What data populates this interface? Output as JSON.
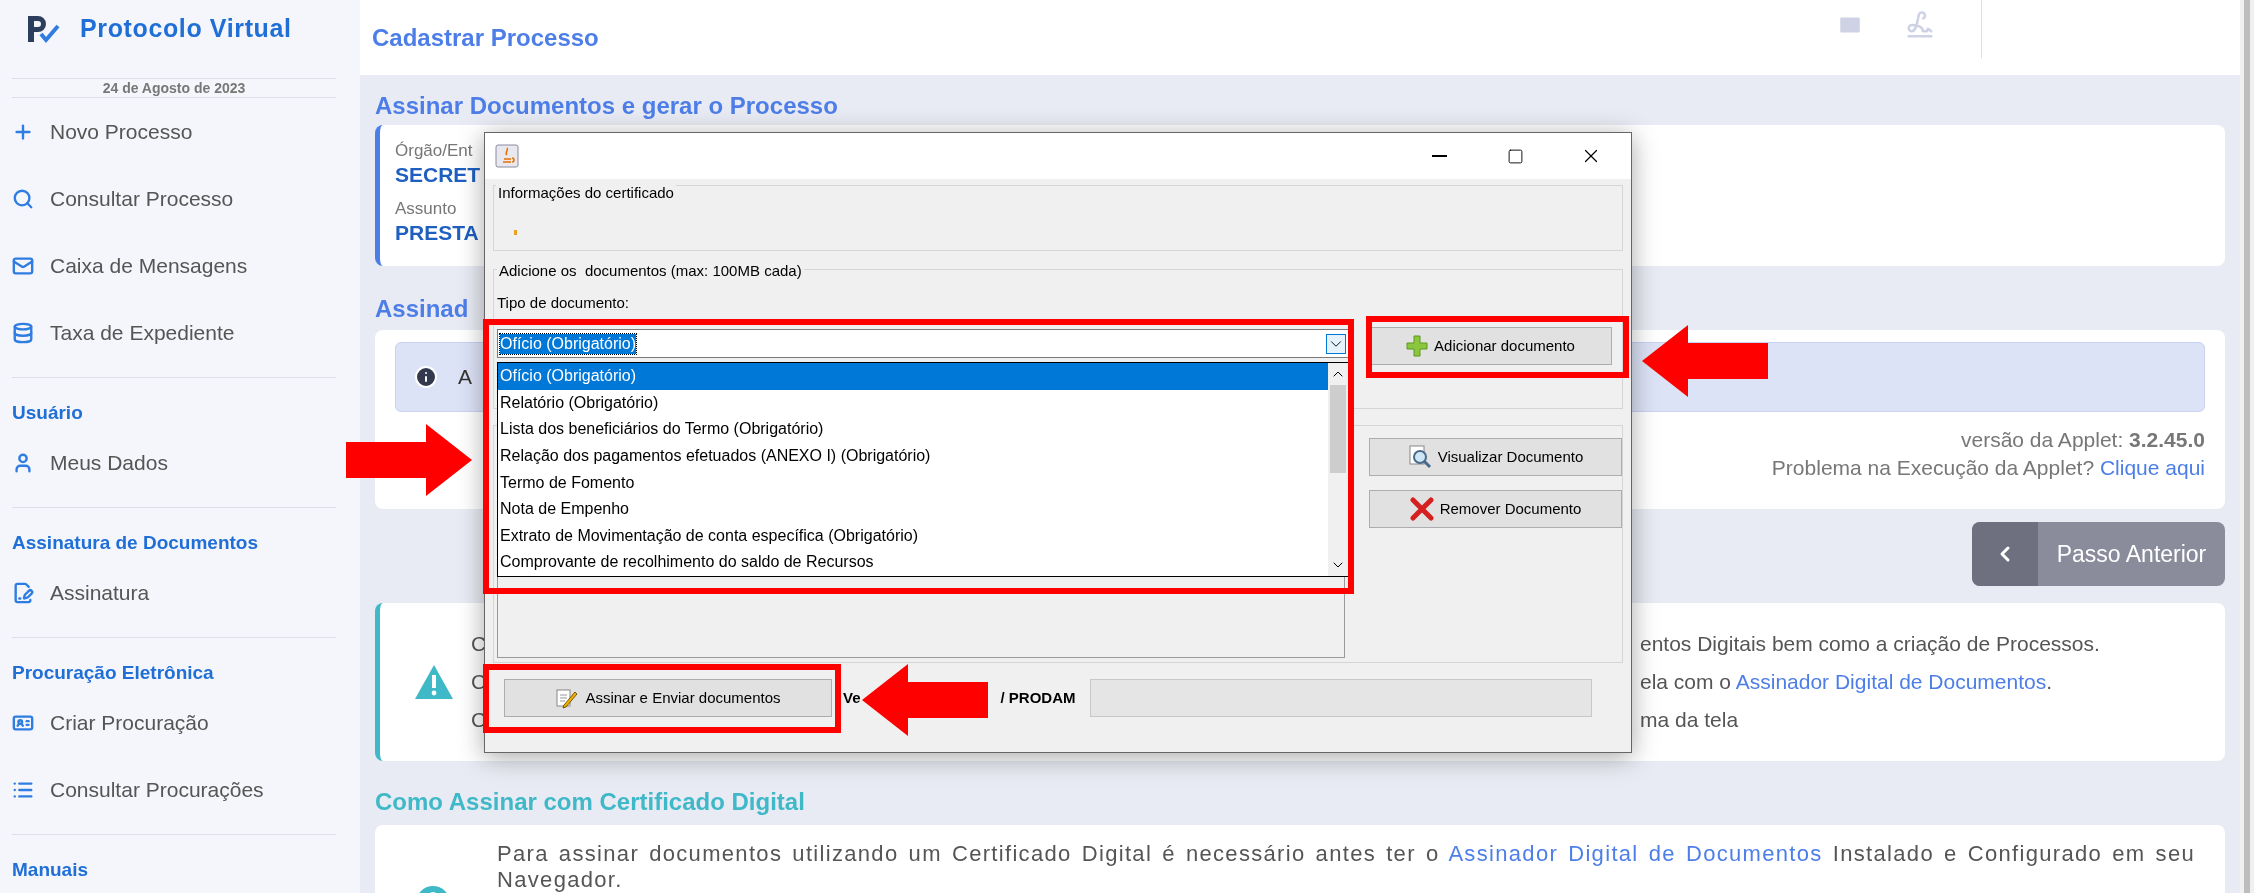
{
  "sidebar": {
    "brand": "Protocolo Virtual",
    "date": "24 de Agosto de 2023",
    "sections": [
      {
        "items": [
          "Novo Processo",
          "Consultar Processo",
          "Caixa de Mensagens",
          "Taxa de Expediente"
        ]
      },
      {
        "heading": "Usuário",
        "items": [
          "Meus Dados"
        ]
      },
      {
        "heading": "Assinatura de Documentos",
        "items": [
          "Assinatura"
        ]
      },
      {
        "heading": "Procuração Eletrônica",
        "items": [
          "Criar Procuração",
          "Consultar Procurações"
        ]
      },
      {
        "heading": "Manuais"
      }
    ]
  },
  "header": {
    "title": "Cadastrar Processo"
  },
  "sign_section": {
    "heading": "Assinar Documentos e gerar o Processo",
    "fields": [
      {
        "label": "Órgão/Ent",
        "value": "SECRET"
      },
      {
        "label": "Assunto",
        "value": "PRESTA"
      }
    ]
  },
  "signer_section": {
    "heading": "Assinad",
    "info_text": "A",
    "version_line": "versão da Applet: **3.2.45.0**",
    "problem_text": "Problema na Execução da Applet?",
    "problem_link": "Clique aqui"
  },
  "back_button": "Passo Anterior",
  "notice": {
    "lines": [
      {
        "left": "C",
        "right": "entos Digitais bem como a criação de Processos."
      },
      {
        "left": "C",
        "right": "ela com o ",
        "link": "Assinador Digital de Documentos",
        "after": "."
      },
      {
        "left": "C",
        "right": "ma da tela"
      }
    ]
  },
  "how_to": {
    "heading": "Como Assinar com Certificado Digital",
    "text": "Para assinar documentos utilizando um Certificado Digital é necessário antes ter o ",
    "link": "Assinador Digital de Documentos",
    "after": " Instalado e Configurado em seu Navegador."
  },
  "dialog": {
    "certificate_group": "Informações do certificado",
    "documents_group": "Adicione os  documentos (max: 100MB cada)",
    "type_label": "Tipo de documento:",
    "combo_value": "Ofício (Obrigatório)",
    "options": [
      {
        "label": "Ofício (Obrigatório)",
        "selected": true
      },
      {
        "label": "Relatório (Obrigatório)",
        "selected": false
      },
      {
        "label": "Lista dos beneficiários do Termo (Obrigatório)",
        "selected": false
      },
      {
        "label": "Relação dos pagamentos efetuados (ANEXO I) (Obrigatório)",
        "selected": false
      },
      {
        "label": "Termo de Fomento",
        "selected": false
      },
      {
        "label": "Nota de Empenho",
        "selected": false
      },
      {
        "label": "Extrato de Movimentação de conta específica (Obrigatório)",
        "selected": false
      },
      {
        "label": "Comprovante de recolhimento do saldo de Recursos",
        "selected": false
      }
    ],
    "add_button": "Adicionar documento",
    "view_button": "Visualizar Documento",
    "remove_button": "Remover Documento",
    "sign_button": "Assinar e Enviar documentos",
    "version_left": "Ve",
    "version_right": "/ PRODAM"
  }
}
